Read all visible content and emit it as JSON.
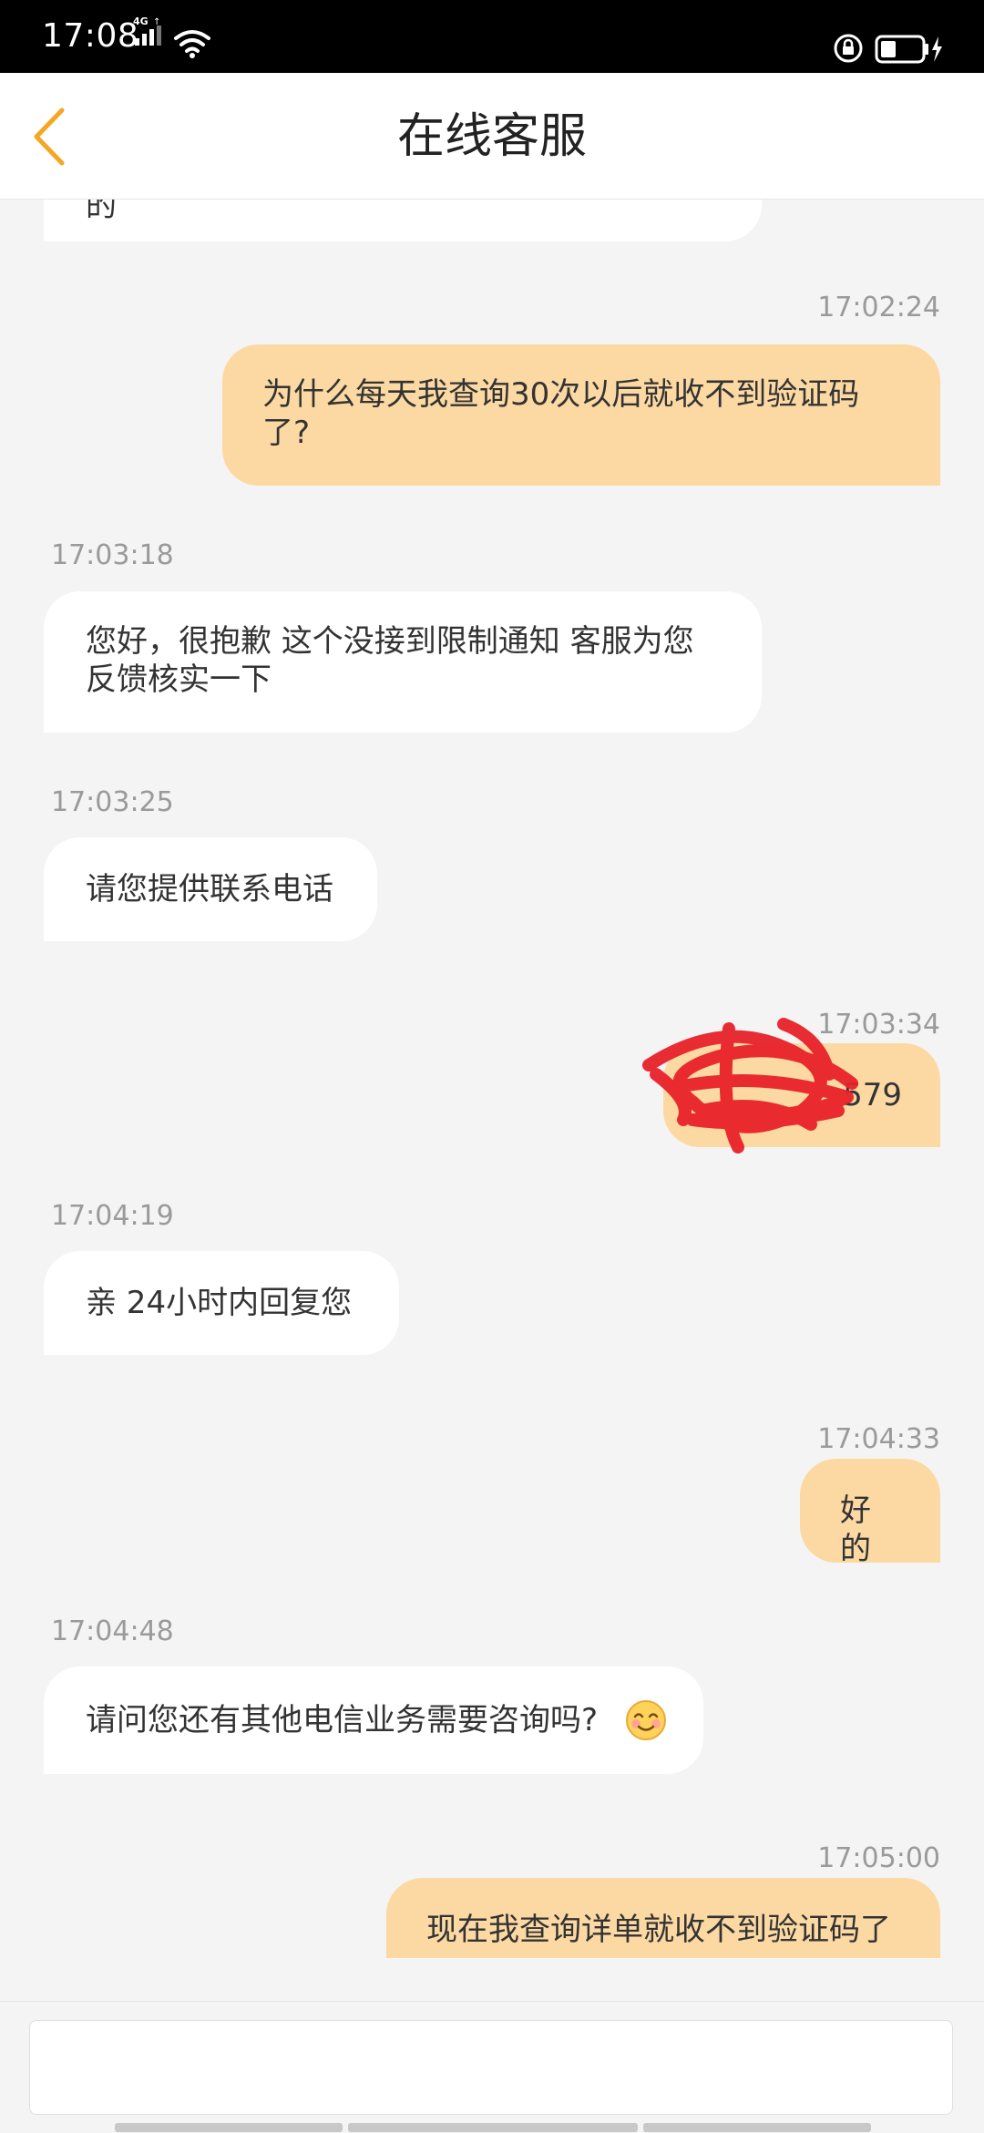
{
  "status_bar": {
    "time": "17:08",
    "network": "4G",
    "network_icon": "signal-icon",
    "wifi_icon": "wifi-icon",
    "lock_icon": "rotation-lock-icon",
    "battery_icon": "battery-charging-icon"
  },
  "header": {
    "title": "在线客服",
    "back_icon": "chevron-left-icon",
    "accent_color": "#f5a623"
  },
  "messages": [
    {
      "sender": "agent",
      "text": "的",
      "partial": true
    },
    {
      "sender": "user",
      "time": "17:02:24",
      "text": "为什么每天我查询30次以后就收不到验证码了?"
    },
    {
      "sender": "agent",
      "time": "17:03:18",
      "text": "您好，很抱歉 这个没接到限制通知 客服为您反馈核实一下"
    },
    {
      "sender": "agent",
      "time": "17:03:25",
      "text": "请您提供联系电话"
    },
    {
      "sender": "user",
      "time": "17:03:34",
      "text": "579",
      "redacted": true
    },
    {
      "sender": "agent",
      "time": "17:04:19",
      "text": "亲 24小时内回复您"
    },
    {
      "sender": "user",
      "time": "17:04:33",
      "text": "好的"
    },
    {
      "sender": "agent",
      "time": "17:04:48",
      "text": "请问您还有其他电信业务需要咨询吗?",
      "emoji": "smiling-face-icon"
    },
    {
      "sender": "user",
      "time": "17:05:00",
      "text": "现在我查询详单就收不到验证码了"
    }
  ],
  "input": {
    "placeholder": "",
    "value": ""
  },
  "colors": {
    "user_bubble": "#fcd9a3",
    "agent_bubble": "#ffffff",
    "background": "#f4f4f4",
    "timestamp": "#9a9a9a",
    "redaction": "#e8222a"
  }
}
